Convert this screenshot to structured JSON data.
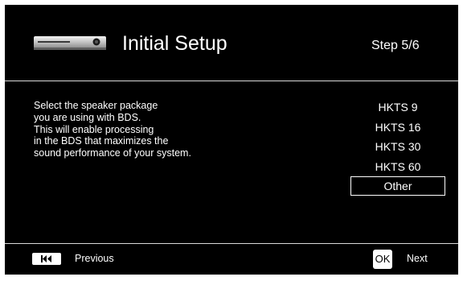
{
  "header": {
    "title": "Initial Setup",
    "step": "Step 5/6",
    "icon": "av-receiver-icon"
  },
  "description": [
    "Select the speaker package",
    "you are using with BDS.",
    "This will enable processing",
    "in the BDS that maximizes the",
    "sound performance of your system."
  ],
  "options": [
    {
      "label": "HKTS 9",
      "selected": false
    },
    {
      "label": "HKTS 16",
      "selected": false
    },
    {
      "label": "HKTS 30",
      "selected": false
    },
    {
      "label": "HKTS 60",
      "selected": false
    },
    {
      "label": "Other",
      "selected": true
    }
  ],
  "footer": {
    "previous_key_icon": "skip-previous-icon",
    "previous_label": "Previous",
    "ok_key": "OK",
    "next_label": "Next"
  },
  "colors": {
    "background": "#000000",
    "text": "#ffffff",
    "divider": "#d9d9d9"
  }
}
